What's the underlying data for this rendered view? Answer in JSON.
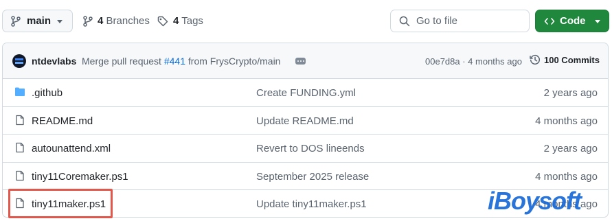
{
  "toolbar": {
    "branch": "main",
    "branches_count": "4",
    "branches_label": "Branches",
    "tags_count": "4",
    "tags_label": "Tags",
    "search_placeholder": "Go to file",
    "code_label": "Code"
  },
  "commit": {
    "author": "ntdevlabs",
    "message_pre": "Merge pull request ",
    "pr": "#441",
    "message_post": " from FrysCrypto/main",
    "sha_time": "00e7d8a · 4 months ago",
    "count_label": "100 Commits"
  },
  "files": [
    {
      "name": ".github",
      "type": "folder",
      "message": "Create FUNDING.yml",
      "date": "2 years ago"
    },
    {
      "name": "README.md",
      "type": "file",
      "message": "Update README.md",
      "date": "4 months ago"
    },
    {
      "name": "autounattend.xml",
      "type": "file",
      "message": "Revert to DOS lineends",
      "date": "2 years ago"
    },
    {
      "name": "tiny11Coremaker.ps1",
      "type": "file",
      "message": "September 2025 release",
      "date": "4 months ago"
    },
    {
      "name": "tiny11maker.ps1",
      "type": "file",
      "message": "Update tiny11maker.ps1",
      "date": "4 months ago"
    }
  ],
  "watermark": "iBoysoft",
  "colors": {
    "accent_green": "#1f883d",
    "link_blue": "#0969da",
    "folder_blue": "#54aeff",
    "highlight_red": "#e2574c"
  }
}
